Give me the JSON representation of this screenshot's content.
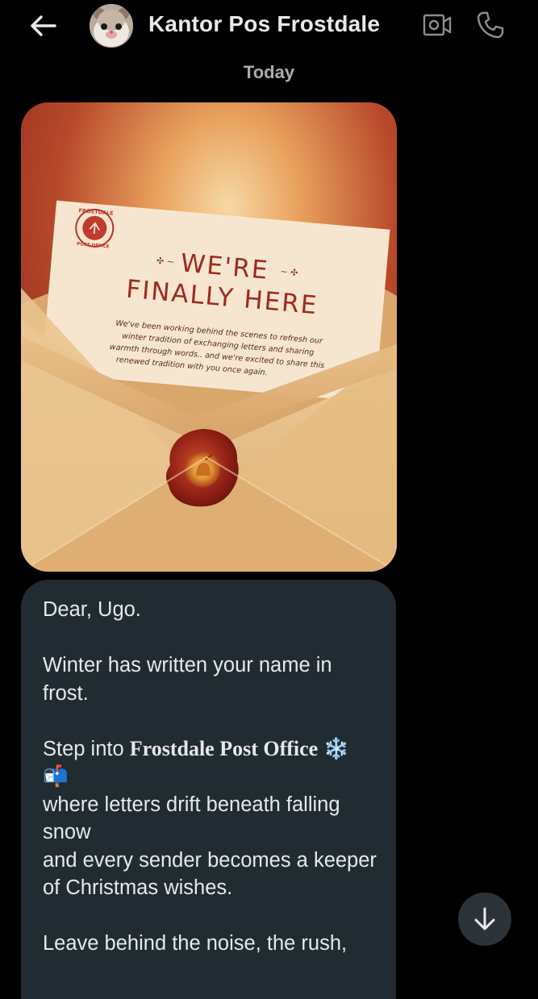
{
  "header": {
    "contact_name": "Kantor Pos Frostdale",
    "back_icon": "arrow-left-icon",
    "video_icon": "video-call-icon",
    "call_icon": "phone-icon"
  },
  "date_separator": "Today",
  "media": {
    "stamp_top": "FROSTDALE",
    "stamp_bottom": "POST OFFICE",
    "headline_line1": "WE'RE",
    "headline_line2": "FINALLY HERE",
    "body_lines": [
      "We've been working behind the scenes to refresh our",
      "winter tradition of exchanging letters and sharing",
      "warmth through words.. and we're excited to share this",
      "renewed tradition with you once again."
    ]
  },
  "message": {
    "greeting": "Dear, Ugo.",
    "para1": "Winter has written your name in frost.",
    "para2_prefix": "Step into ",
    "para2_bold": "Frostdale Post Office",
    "para2_emoji": "❄️",
    "para2_emoji2": "📬",
    "para2_rest": "where letters drift beneath falling snow\nand every sender becomes a keeper of Christmas wishes.",
    "para3": "Leave behind the noise, the rush,"
  },
  "colors": {
    "background": "#000000",
    "bubble": "#212b32",
    "text": "#e7e9ea",
    "muted": "#a9adb1",
    "accent_red": "#9e2a22"
  },
  "scroll_button_icon": "arrow-down-icon"
}
